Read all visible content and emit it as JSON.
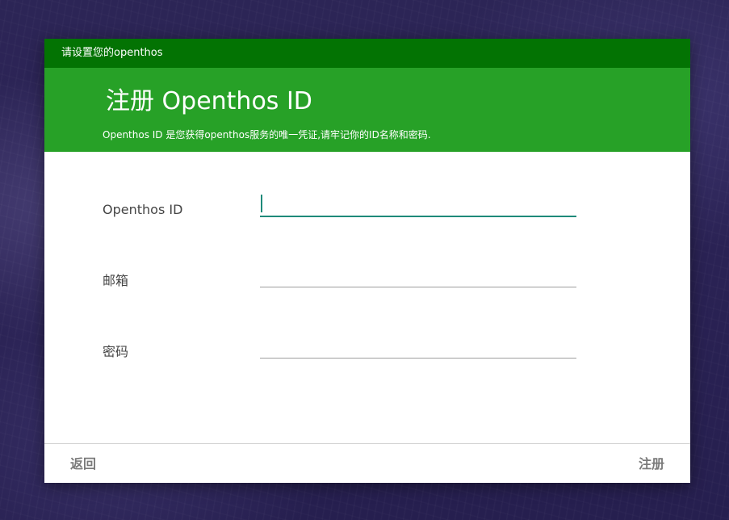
{
  "dialog": {
    "window_title": "请设置您的openthos",
    "heading": "注册 Openthos ID",
    "subheading": "Openthos ID 是您获得openthos服务的唯一凭证,请牢记你的ID名称和密码."
  },
  "form": {
    "fields": [
      {
        "label": "Openthos ID",
        "value": "",
        "focused": true
      },
      {
        "label": "邮箱",
        "value": ""
      },
      {
        "label": "密码",
        "value": ""
      }
    ]
  },
  "footer": {
    "back_label": "返回",
    "register_label": "注册"
  },
  "colors": {
    "title_bar": "#037303",
    "header": "#27a127",
    "focus_accent": "#1e8a7a",
    "background": "#2c2556"
  }
}
